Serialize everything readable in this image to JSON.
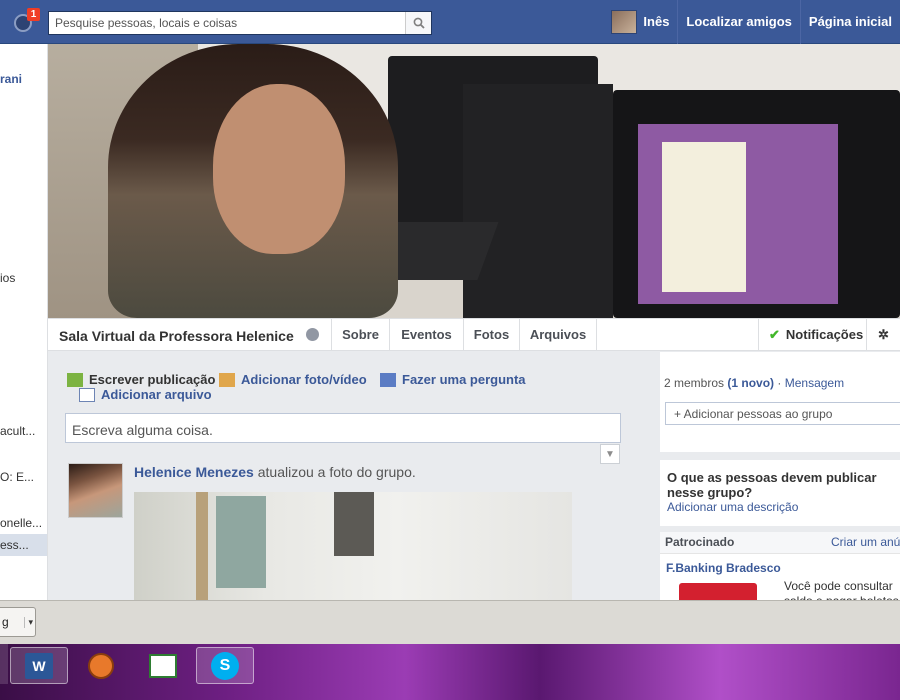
{
  "topbar": {
    "notification_count": "1",
    "search_placeholder": "Pesquise pessoas, locais e coisas",
    "user_name": "Inês",
    "find_friends": "Localizar amigos",
    "home": "Página inicial"
  },
  "left_sidebar": {
    "items": [
      "rani",
      "ios",
      "acult...",
      "O: E...",
      "onelle...",
      "ess...",
      "g"
    ]
  },
  "group": {
    "name": "Sala Virtual da Professora Helenice",
    "tabs": [
      "Sobre",
      "Eventos",
      "Fotos",
      "Arquivos"
    ],
    "notifications": "Notificações"
  },
  "composer": {
    "write_post": "Escrever publicação",
    "add_photo": "Adicionar foto/vídeo",
    "ask_question": "Fazer uma pergunta",
    "add_file": "Adicionar arquivo",
    "placeholder": "Escreva alguma coisa."
  },
  "post": {
    "author": "Helenice Menezes",
    "action": "atualizou a foto do grupo."
  },
  "right_column": {
    "members_count": "2 membros",
    "new_count": "(1 novo)",
    "separator": "·",
    "message": "Mensagem",
    "add_people": "+ Adicionar pessoas ao grupo",
    "question": "O que as pessoas devem publicar nesse grupo?",
    "add_description": "Adicionar uma descrição",
    "sponsored": "Patrocinado",
    "create_ad": "Criar um anú",
    "ad_title": "F.Banking Bradesco",
    "ad_text": "Você pode consultar saldo e pagar boletos"
  },
  "taskbar": {
    "items": [
      "word-icon",
      "paw-icon",
      "window-icon",
      "skype-icon"
    ]
  },
  "colors": {
    "brand_blue": "#3b5998",
    "notification_red": "#f03d25",
    "check_green": "#42b72a"
  }
}
